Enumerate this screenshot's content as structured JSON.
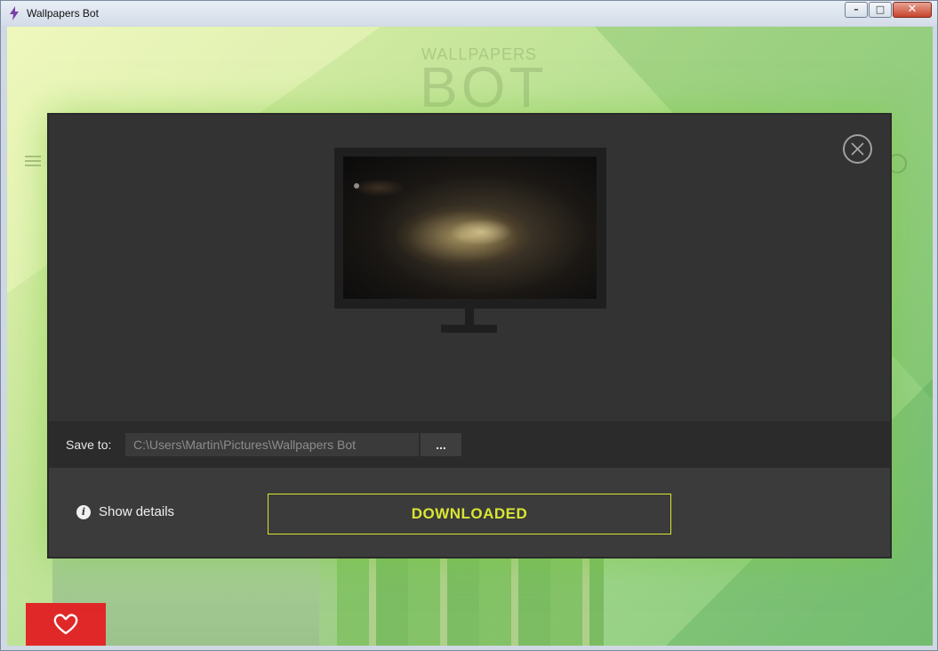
{
  "window": {
    "title": "Wallpapers Bot",
    "controls": {
      "minimize": "–",
      "maximize": "□",
      "close": "✕"
    }
  },
  "background": {
    "logo_top": "WALLPAPERS",
    "logo_bottom": "BOT"
  },
  "modal": {
    "save_label": "Save to:",
    "save_path": "C:\\Users\\Martin\\Pictures\\Wallpapers Bot",
    "browse_label": "...",
    "details_label": "Show details",
    "download_label": "DOWNLOADED"
  },
  "icons": {
    "app": "lightning-icon",
    "close_modal": "close-icon",
    "info": "info-icon",
    "favorite": "heart-icon",
    "menu": "menu-icon",
    "search": "search-icon"
  },
  "colors": {
    "accent": "#d8e632",
    "favorite": "#e02828",
    "modal_bg": "#333333"
  }
}
